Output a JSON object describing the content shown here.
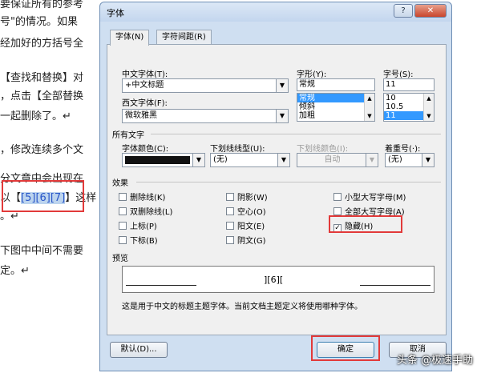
{
  "document": {
    "lines": [
      "要保证所有的参考",
      "号\"的情况。如果",
      "经加好的方括号全",
      "【查找和替换】对",
      "，点击【全部替换",
      "一起删除了。↵",
      "，修改连续多个文",
      "分文章中会出现在",
      "。↵",
      "下图中中间不需要",
      "定。↵"
    ],
    "example_prefix": "以【",
    "example_refs": [
      "[5]",
      "[6]",
      "[7]"
    ],
    "example_suffix": "】这样"
  },
  "dialog": {
    "title": "字体",
    "help": "?",
    "close": "✕",
    "tabs": [
      "字体(N)",
      "字符间距(R)"
    ],
    "chinese_font": {
      "label": "中文字体(T):",
      "value": "+中文标题"
    },
    "western_font": {
      "label": "西文字体(F):",
      "value": "微软雅黑"
    },
    "style": {
      "label": "字形(Y):",
      "value": "常规",
      "options": [
        "常规",
        "倾斜",
        "加粗"
      ],
      "selected": "常规"
    },
    "size": {
      "label": "字号(S):",
      "value": "11",
      "options": [
        "10",
        "10.5",
        "11"
      ],
      "selected": "11"
    },
    "all_text": {
      "title": "所有文字",
      "font_color": {
        "label": "字体颜色(C):",
        "color": "#111111"
      },
      "underline": {
        "label": "下划线线型(U):",
        "value": "(无)"
      },
      "underline_color": {
        "label": "下划线颜色(I):",
        "value": "自动"
      },
      "emphasis": {
        "label": "着重号(·):",
        "value": "(无)"
      }
    },
    "effects": {
      "title": "效果",
      "items": [
        {
          "label": "删除线(K)",
          "checked": false
        },
        {
          "label": "双删除线(L)",
          "checked": false
        },
        {
          "label": "上标(P)",
          "checked": false
        },
        {
          "label": "下标(B)",
          "checked": false
        },
        {
          "label": "阴影(W)",
          "checked": false
        },
        {
          "label": "空心(O)",
          "checked": false
        },
        {
          "label": "阳文(E)",
          "checked": false
        },
        {
          "label": "阴文(G)",
          "checked": false
        },
        {
          "label": "小型大写字母(M)",
          "checked": false
        },
        {
          "label": "全部大写字母(A)",
          "checked": false
        },
        {
          "label": "隐藏(H)",
          "checked": true
        }
      ]
    },
    "preview": {
      "title": "预览",
      "sample": "][6][",
      "note": "这是用于中文的标题主题字体。当前文档主题定义将使用哪种字体。"
    },
    "buttons": {
      "default": "默认(D)...",
      "ok": "确定",
      "cancel": "取消"
    }
  },
  "watermark": "头条 @极速手助"
}
